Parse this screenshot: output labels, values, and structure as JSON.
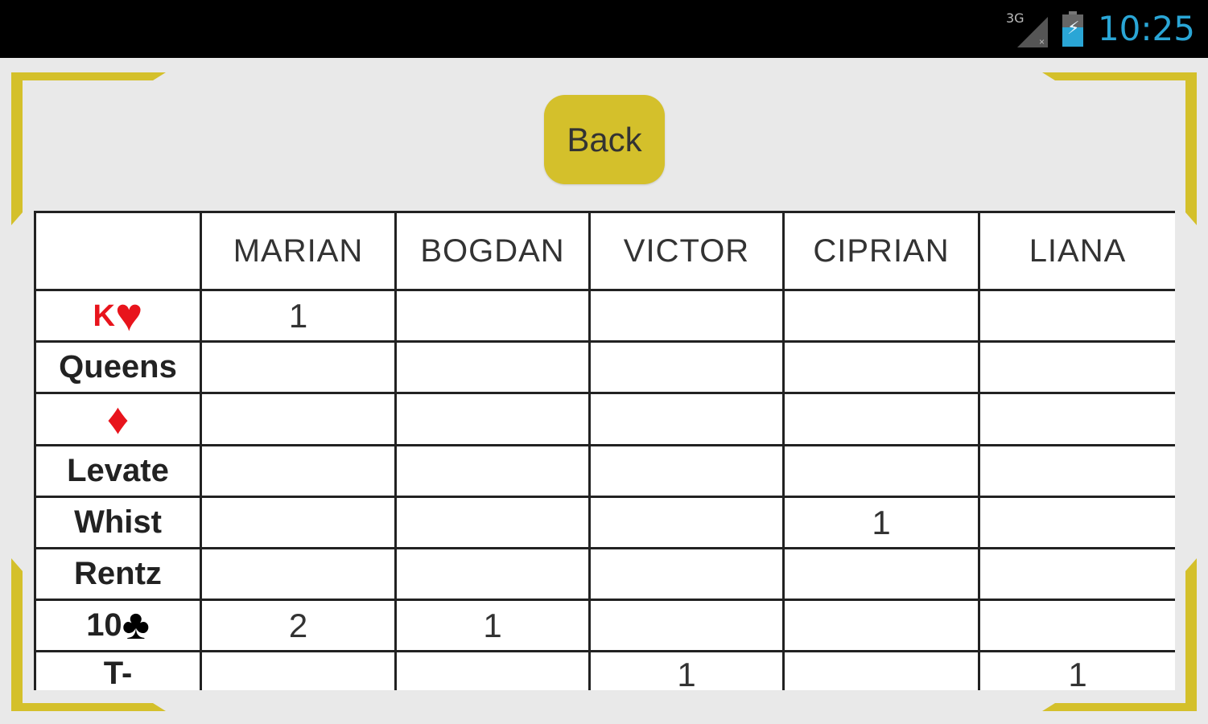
{
  "statusbar": {
    "network": "3G",
    "time": "10:25"
  },
  "back_button": "Back",
  "table": {
    "players": [
      "MARIAN",
      "BOGDAN",
      "VICTOR",
      "CIPRIAN",
      "LIANA"
    ],
    "rows": [
      {
        "label": "K",
        "label_icon": "heart-icon",
        "cells": [
          "1",
          "",
          "",
          "",
          ""
        ]
      },
      {
        "label": "Queens",
        "cells": [
          "",
          "",
          "",
          "",
          ""
        ]
      },
      {
        "label": "",
        "label_icon": "diamond-icon",
        "cells": [
          "",
          "",
          "",
          "",
          ""
        ]
      },
      {
        "label": "Levate",
        "cells": [
          "",
          "",
          "",
          "",
          ""
        ]
      },
      {
        "label": "Whist",
        "cells": [
          "",
          "",
          "",
          "1",
          ""
        ]
      },
      {
        "label": "Rentz",
        "cells": [
          "",
          "",
          "",
          "",
          ""
        ]
      },
      {
        "label": "10",
        "label_icon": "club-icon",
        "cells": [
          "2",
          "1",
          "",
          "",
          ""
        ]
      },
      {
        "label": "T-",
        "cells": [
          "",
          "",
          "1",
          "",
          "1"
        ]
      }
    ]
  },
  "colors": {
    "accent": "#d4c02b",
    "suit_red": "#e8141c",
    "clock": "#2aa6d6"
  }
}
